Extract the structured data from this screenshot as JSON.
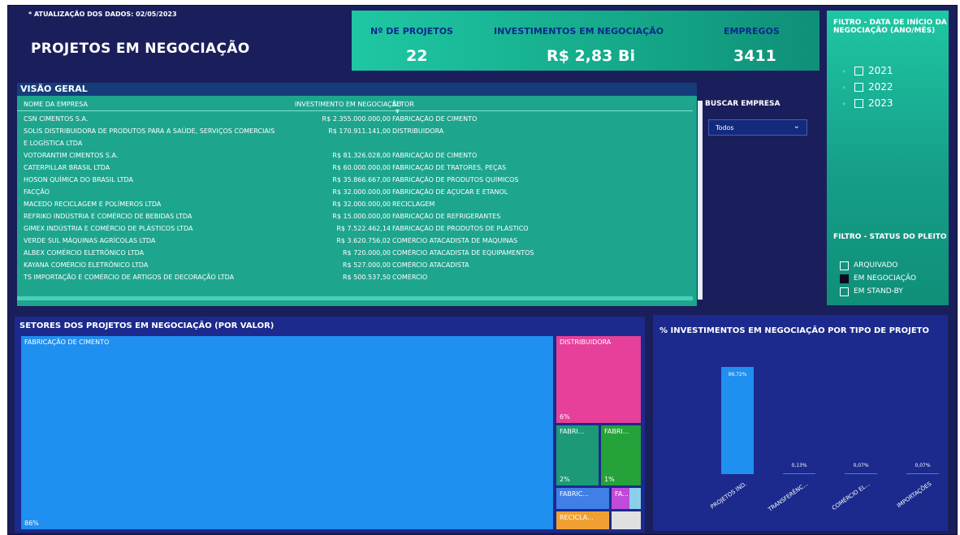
{
  "update_note": "* ATUALIZAÇÃO DOS DADOS: 02/05/2023",
  "page_title": "PROJETOS EM NEGOCIAÇÃO",
  "kpis": {
    "projects_label": "Nº DE PROJETOS",
    "projects_value": "22",
    "investments_label": "INVESTIMENTOS EM NEGOCIAÇÃO",
    "investments_value": "R$ 2,83 Bi",
    "jobs_label": "EMPREGOS",
    "jobs_value": "3411"
  },
  "date_filter": {
    "title": "FILTRO - DATA DE INÍCIO DA NEGOCIAÇÃO (ANO/MÊS)",
    "years": [
      "2021",
      "2022",
      "2023"
    ]
  },
  "overview": {
    "title": "VISÃO GERAL",
    "col_company": "NOME DA EMPRESA",
    "col_investment": "INVESTIMENTO EM NEGOCIAÇÃO",
    "col_sector": "SETOR",
    "rows": [
      {
        "company": "CSN CIMENTOS S.A.",
        "investment": "R$ 2.355.000.000,00",
        "sector": "FABRICAÇÃO DE CIMENTO"
      },
      {
        "company": "SOLIS DISTRIBUIDORA DE PRODUTOS PARA A SAÚDE, SERVIÇOS COMERCIAIS",
        "investment": "R$ 170.911.141,00",
        "sector": "DISTRIBUIDORA"
      },
      {
        "company": "E LOGÍSTICA LTDA",
        "investment": "",
        "sector": ""
      },
      {
        "company": "VOTORANTIM CIMENTOS S.A.",
        "investment": "R$ 81.326.028,00",
        "sector": "FABRICAÇÃO DE CIMENTO"
      },
      {
        "company": "CATERPILLAR BRASIL LTDA",
        "investment": "R$ 60.000.000,00",
        "sector": "FABRICAÇÃO DE TRATORES, PEÇAS"
      },
      {
        "company": "HOSON QUÍMICA DO BRASIL LTDA",
        "investment": "R$ 35.866.667,00",
        "sector": "FABRICAÇÃO DE PRODUTOS QUÍMICOS"
      },
      {
        "company": "FACÇÃO",
        "investment": "R$ 32.000.000,00",
        "sector": "FABRICAÇÃO DE AÇÚCAR E ETANOL"
      },
      {
        "company": "MACEDO RECICLAGEM E POLÍMEROS LTDA",
        "investment": "R$ 32.000.000,00",
        "sector": "RECICLAGEM"
      },
      {
        "company": "REFRIKO INDÚSTRIA E COMÉRCIO DE BEBIDAS LTDA",
        "investment": "R$ 15.000.000,00",
        "sector": "FABRICAÇÃO DE REFRIGERANTES"
      },
      {
        "company": "GIMEX INDÚSTRIA E COMÉRCIO DE PLÁSTICOS LTDA",
        "investment": "R$ 7.522.462,14",
        "sector": "FABRICAÇÃO DE PRODUTOS DE PLÁSTICO"
      },
      {
        "company": "VERDE SUL MÁQUINAS AGRÍCOLAS LTDA",
        "investment": "R$ 3.620.756,02",
        "sector": "COMÉRCIO ATACADISTA DE MÁQUINAS"
      },
      {
        "company": "ALBEX COMÉRCIO ELETRÔNICO LTDA",
        "investment": "R$ 720.000,00",
        "sector": "COMÉRCIO ATACADISTA DE EQUIPAMENTOS"
      },
      {
        "company": "KAYANA COMÉRCIO ELETRÔNICO LTDA",
        "investment": "R$ 527.000,00",
        "sector": "COMÉRCIO ATACADISTA"
      },
      {
        "company": "TS IMPORTAÇÃO E COMÉRCIO DE ARTIGOS DE DECORAÇÃO LTDA",
        "investment": "R$ 500.537,50",
        "sector": "COMÉRCIO"
      }
    ]
  },
  "search": {
    "label": "BUSCAR EMPRESA",
    "value": "Todos"
  },
  "status_filter": {
    "title": "FILTRO - STATUS DO PLEITO",
    "options": [
      {
        "label": "ARQUIVADO",
        "checked": false
      },
      {
        "label": "EM NEGOCIAÇÃO",
        "checked": true
      },
      {
        "label": "EM STAND-BY",
        "checked": false
      }
    ]
  },
  "treemap": {
    "title": "SETORES DOS PROJETOS EM NEGOCIAÇÃO (POR VALOR)",
    "tiles": [
      {
        "label": "FABRICAÇÃO DE CIMENTO",
        "pct": "86%",
        "color": "#1f8ff0"
      },
      {
        "label": "DISTRIBUIDORA",
        "pct": "6%",
        "color": "#e6409a"
      },
      {
        "label": "FABRI...",
        "pct": "2%",
        "color": "#1c9a78"
      },
      {
        "label": "FABRI...",
        "pct": "1%",
        "color": "#25a23a"
      },
      {
        "label": "FABRIC...",
        "pct": "",
        "color": "#3f7fe6"
      },
      {
        "label": "FA...",
        "pct": "",
        "color": "#c04bd8"
      },
      {
        "label": "RECICLA...",
        "pct": "",
        "color": "#f0a033"
      }
    ]
  },
  "chart_data": {
    "type": "bar",
    "title": "% INVESTIMENTOS EM NEGOCIAÇÃO POR TIPO DE PROJETO",
    "categories": [
      "PROJETOS IND.",
      "TRANSFERÊNC...",
      "COMÉRCIO EL...",
      "IMPORTAÇÕES"
    ],
    "values": [
      99.72,
      0.13,
      0.07,
      0.07
    ],
    "data_labels": [
      "99,72%",
      "0,13%",
      "0,07%",
      "0,07%"
    ],
    "xlabel": "",
    "ylabel": "",
    "ylim": [
      0,
      100
    ],
    "grid": false,
    "color": "#1f8ff0"
  }
}
